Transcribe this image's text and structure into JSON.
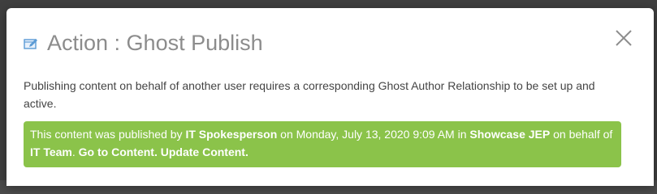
{
  "dialog": {
    "title": "Action : Ghost Publish",
    "title_icon": "edit-window-icon",
    "close_icon": "close-icon",
    "description": "Publishing content on behalf of another user requires a corresponding Ghost Author Relationship to be set up and active."
  },
  "alert": {
    "t1": "This content was published by ",
    "author": "IT Spokesperson",
    "t2": " on Monday, July 13, 2020 9:09 AM in ",
    "place": "Showcase JEP",
    "t3": " on behalf of ",
    "behalf": "IT Team",
    "t4": ". ",
    "go_link": "Go to Content.",
    "t5": " ",
    "update_link": "Update Content.",
    "color": "#8bc34a"
  },
  "colors": {
    "title": "#8c8c8c",
    "text": "#444444",
    "icon_accent": "#5b9bd5"
  }
}
